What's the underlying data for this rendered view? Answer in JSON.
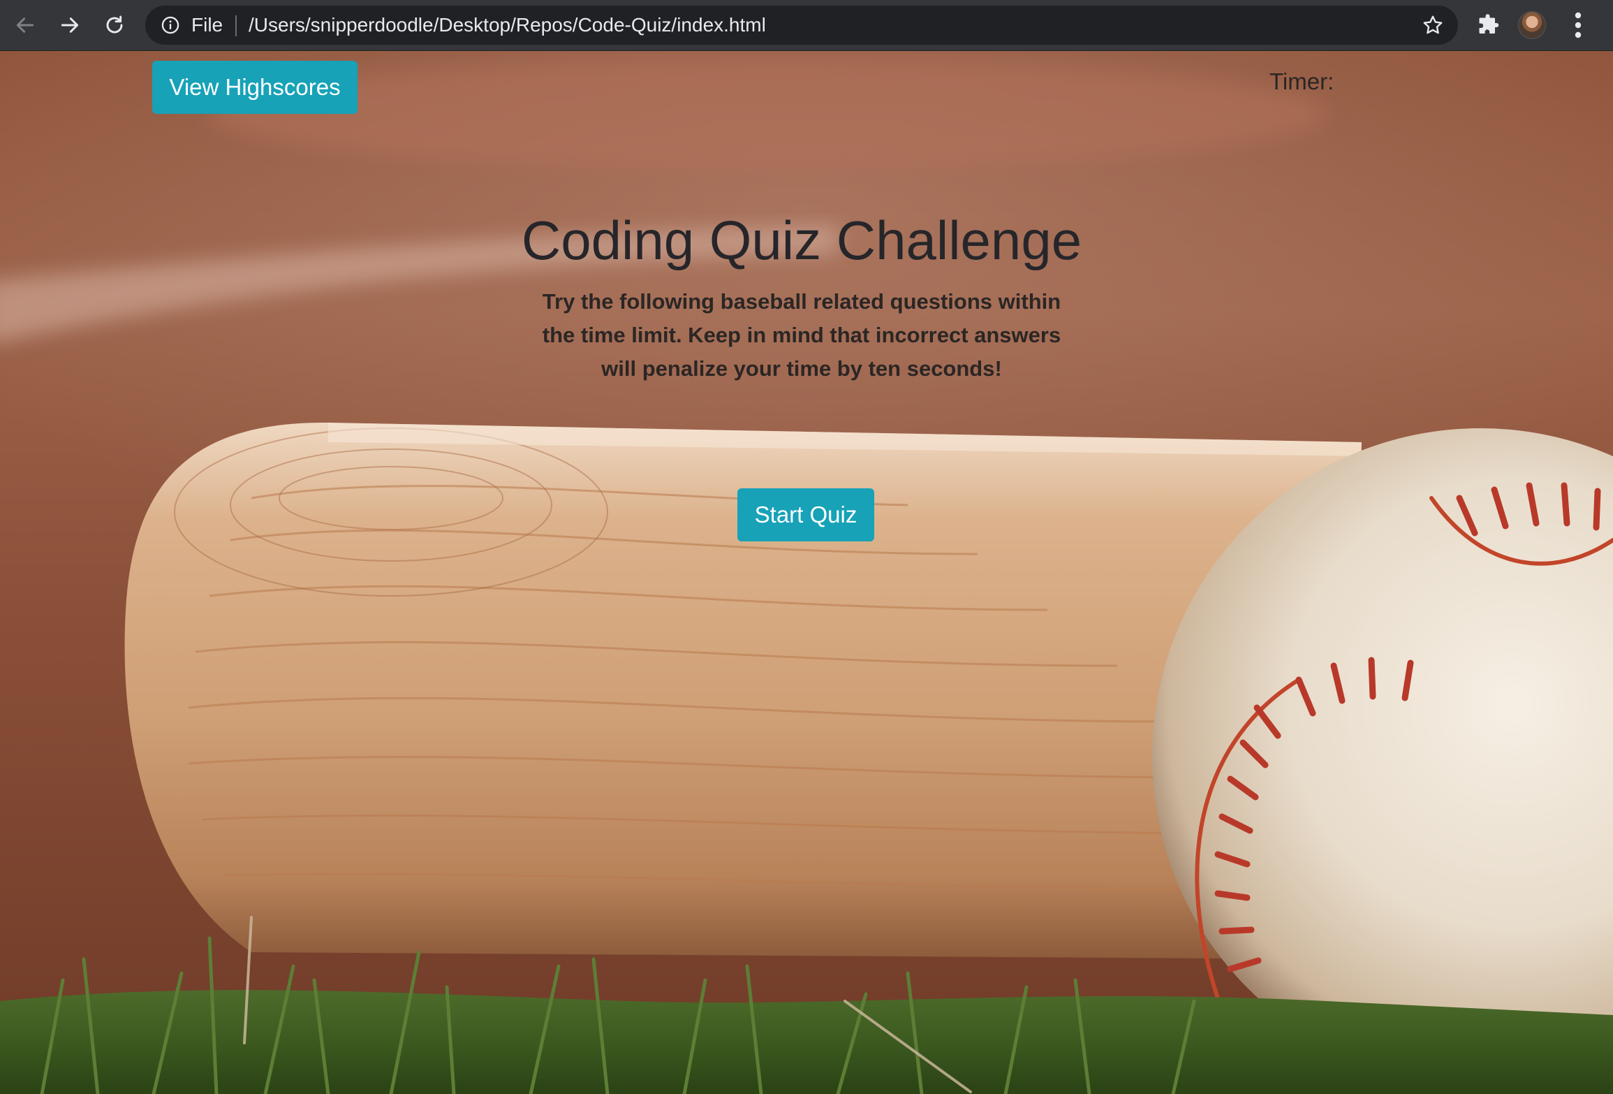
{
  "browser": {
    "scheme_label": "File",
    "url": "/Users/snipperdoodle/Desktop/Repos/Code-Quiz/index.html",
    "icons": [
      "back-arrow-icon",
      "forward-arrow-icon",
      "reload-icon",
      "info-icon",
      "bookmark-star-icon",
      "extensions-puzzle-icon",
      "profile-avatar",
      "more-menu-icon"
    ]
  },
  "page": {
    "highscores_label": "View Highscores",
    "timer_label": "Timer:",
    "title": "Coding Quiz Challenge",
    "intro": "Try the following baseball related questions within the time limit. Keep in mind that incorrect answers will penalize your time by ten seconds!",
    "start_label": "Start Quiz",
    "background": "baseball bat and ball on grass"
  },
  "colors": {
    "accent_teal": "#17a2b8",
    "browser_chrome": "#35363a",
    "omnibox": "#202124",
    "text_dark": "#26262a"
  }
}
